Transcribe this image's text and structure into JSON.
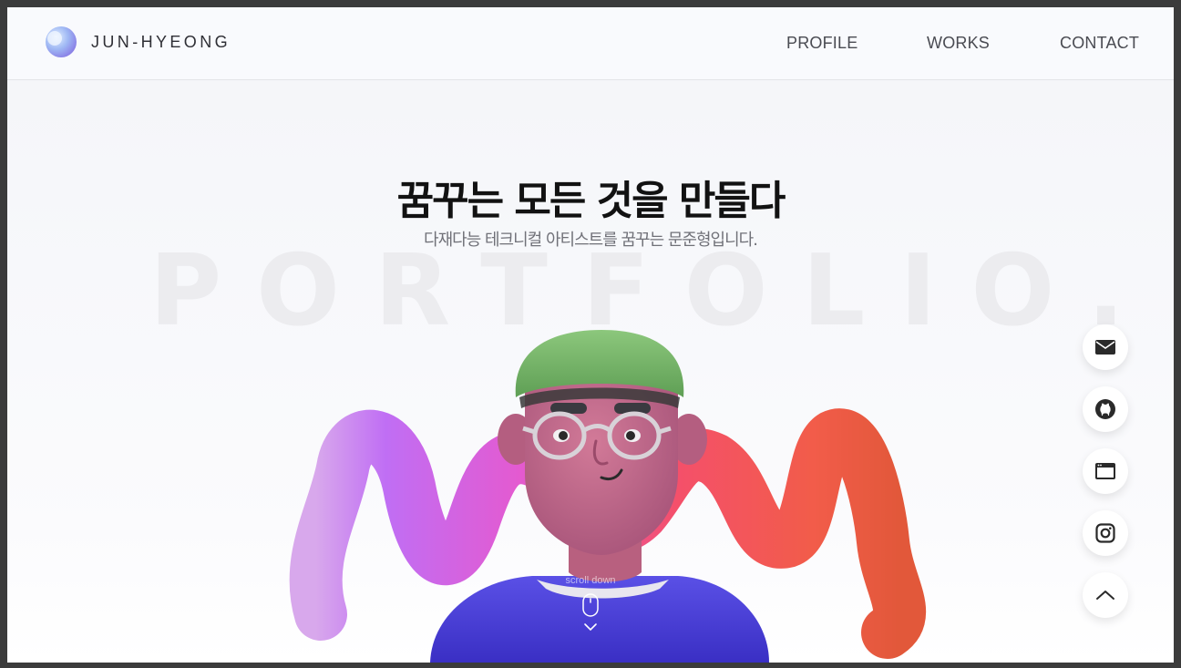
{
  "header": {
    "brand": "JUN-HYEONG",
    "nav": [
      {
        "label": "PROFILE"
      },
      {
        "label": "WORKS"
      },
      {
        "label": "CONTACT"
      }
    ]
  },
  "hero": {
    "headline": "꿈꾸는 모든 것을 만들다",
    "subline": "다재다능 테크니컬 아티스트를 꿈꾸는 문준형입니다.",
    "watermark": "PORTFOLIO.",
    "scroll_label": "scroll down"
  },
  "social": [
    {
      "icon": "mail-icon"
    },
    {
      "icon": "github-icon"
    },
    {
      "icon": "browser-window-icon"
    },
    {
      "icon": "instagram-icon"
    },
    {
      "icon": "chevron-up-icon"
    }
  ],
  "colors": {
    "page_background": "#f4f5f8",
    "text_dark": "#121212",
    "text_muted": "#707178",
    "watermark": "#ececef",
    "hat": "#79b86b",
    "skin": "#c26a8a",
    "shirt": "#4b40d8",
    "squiggle_start": "#c07cf0",
    "squiggle_mid": "#f2506e",
    "squiggle_end": "#e8583a"
  }
}
